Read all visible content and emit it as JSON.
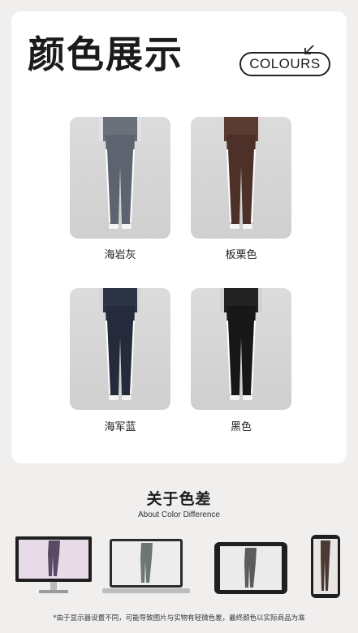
{
  "header": {
    "title": "颜色展示",
    "badge_label": "COLOURS"
  },
  "swatches": [
    {
      "name": "海岩灰",
      "pants": "#5d6470",
      "top": "#6b717b"
    },
    {
      "name": "板栗色",
      "pants": "#4d3129",
      "top": "#5a3c33"
    },
    {
      "name": "海军蓝",
      "pants": "#252b3b",
      "top": "#2d3446"
    },
    {
      "name": "黑色",
      "pants": "#171717",
      "top": "#222222"
    }
  ],
  "difference": {
    "title": "关于色差",
    "subtitle": "About Color Difference",
    "devices": [
      "desktop-monitor",
      "imac",
      "tablet",
      "phone"
    ],
    "note": "*由于显示器设置不同，可能导致图片与实物有轻微色差，最终颜色以实际商品为准"
  }
}
